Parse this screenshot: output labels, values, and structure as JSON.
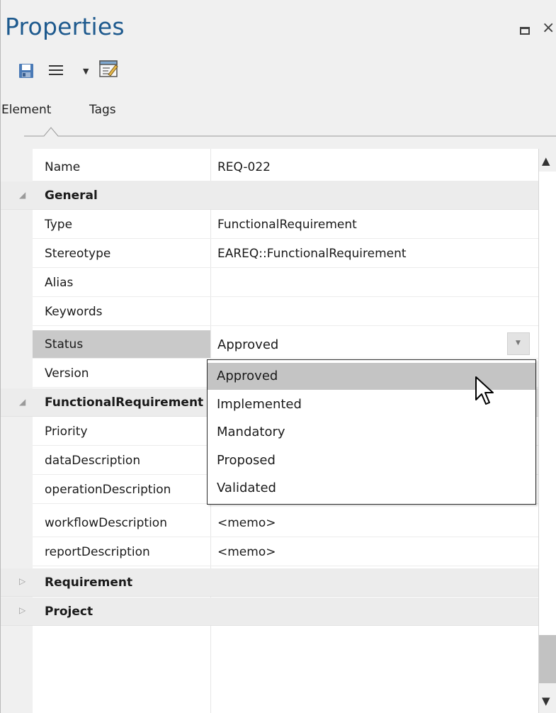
{
  "panel": {
    "title": "Properties"
  },
  "toolbar": {
    "save_icon": "save-icon",
    "menu_icon": "hamburger-menu-icon",
    "properties_icon": "properties-icon"
  },
  "tabs": [
    {
      "label": "Element",
      "active": true
    },
    {
      "label": "Tags",
      "active": false
    }
  ],
  "grid": {
    "name_row": {
      "label": "Name",
      "value": "REQ-022"
    },
    "groups": [
      {
        "label": "General",
        "expanded": true,
        "rows": [
          {
            "label": "Type",
            "value": "FunctionalRequirement"
          },
          {
            "label": "Stereotype",
            "value": "EAREQ::FunctionalRequirement"
          },
          {
            "label": "Alias",
            "value": ""
          },
          {
            "label": "Keywords",
            "value": ""
          },
          {
            "label": "Status",
            "value": "Approved"
          },
          {
            "label": "Version",
            "value": ""
          }
        ]
      },
      {
        "label": "FunctionalRequirement",
        "expanded": true,
        "rows": [
          {
            "label": "Priority",
            "value": ""
          },
          {
            "label": "dataDescription",
            "value": ""
          },
          {
            "label": "operationDescription",
            "value": ""
          },
          {
            "label": "workflowDescription",
            "value": "<memo>"
          },
          {
            "label": "reportDescription",
            "value": "<memo>"
          }
        ]
      },
      {
        "label": "Requirement",
        "expanded": false
      },
      {
        "label": "Project",
        "expanded": false
      }
    ]
  },
  "status_dropdown": {
    "options": [
      "Approved",
      "Implemented",
      "Mandatory",
      "Proposed",
      "Validated"
    ],
    "highlighted": "Approved"
  },
  "colors": {
    "title": "#1e5a8e",
    "selected_row": "#c9c9c9",
    "dropdown_highlight": "#c4c4c4"
  }
}
